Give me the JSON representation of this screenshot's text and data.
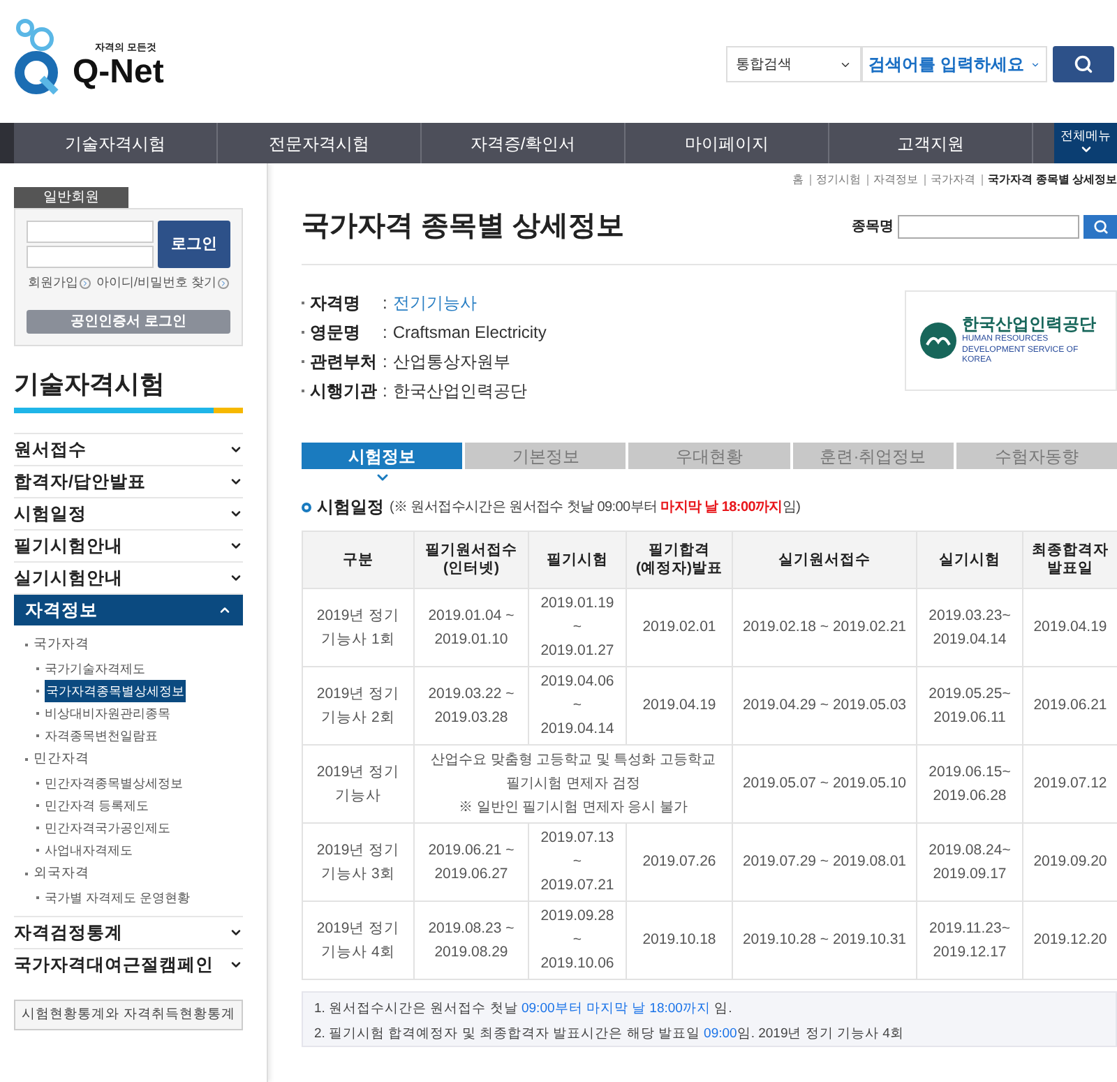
{
  "header": {
    "logo_tagline": "자격의 모든것",
    "logo_text": "Q-Net",
    "search_scope": "통합검색",
    "search_placeholder": "검색어를 입력하세요"
  },
  "nav": {
    "items": [
      "기술자격시험",
      "전문자격시험",
      "자격증/확인서",
      "마이페이지",
      "고객지원"
    ],
    "all_menu": "전체메뉴"
  },
  "sidebar": {
    "member_tab": "일반회원",
    "login_button": "로그인",
    "links": [
      "회원가입",
      "아이디/비밀번호 찾기"
    ],
    "cert_button": "공인인증서 로그인",
    "section_title": "기술자격시험",
    "menu": [
      {
        "label": "원서접수",
        "expanded": false
      },
      {
        "label": "합격자/답안발표",
        "expanded": false
      },
      {
        "label": "시험일정",
        "expanded": false
      },
      {
        "label": "필기시험안내",
        "expanded": false
      },
      {
        "label": "실기시험안내",
        "expanded": false
      },
      {
        "label": "자격정보",
        "expanded": true,
        "children": [
          {
            "label": "국가자격",
            "children": [
              {
                "label": "국가기술자격제도",
                "selected": false
              },
              {
                "label": "국가자격종목별상세정보",
                "selected": true
              },
              {
                "label": "비상대비자원관리종목",
                "selected": false
              },
              {
                "label": "자격종목변천일람표",
                "selected": false
              }
            ]
          },
          {
            "label": "민간자격",
            "children": [
              {
                "label": "민간자격종목별상세정보",
                "selected": false
              },
              {
                "label": "민간자격 등록제도",
                "selected": false
              },
              {
                "label": "민간자격국가공인제도",
                "selected": false
              },
              {
                "label": "사업내자격제도",
                "selected": false
              }
            ]
          },
          {
            "label": "외국자격",
            "children": [
              {
                "label": "국가별 자격제도 운영현황",
                "selected": false
              }
            ]
          }
        ]
      },
      {
        "label": "자격검정통계",
        "expanded": false
      },
      {
        "label": "국가자격대여근절캠페인",
        "expanded": false
      }
    ],
    "stats_button": "시험현황통계와 자격취득현황통계"
  },
  "breadcrumb": [
    "홈",
    "정기시험",
    "자격정보",
    "국가자격",
    "국가자격 종목별 상세정보"
  ],
  "page_title": "국가자격 종목별 상세정보",
  "item_search": {
    "label": "종목명"
  },
  "info": [
    {
      "label": "자격명",
      "separator": ":",
      "value": "전기기능사",
      "kind": "link"
    },
    {
      "label": "영문명",
      "separator": ":",
      "value": "Craftsman Electricity",
      "kind": "text"
    },
    {
      "label": "관련부처",
      "separator": ":",
      "value": "산업통상자원부",
      "kind": "text"
    },
    {
      "label": "시행기관",
      "separator": ":",
      "value": "한국산업인력공단",
      "kind": "text"
    }
  ],
  "agency_logo": {
    "name": "한국산업인력공단",
    "english": "HUMAN RESOURCES DEVELOPMENT SERVICE OF KOREA"
  },
  "tabs": [
    {
      "label": "시험정보",
      "selected": true
    },
    {
      "label": "기본정보",
      "selected": false
    },
    {
      "label": "우대현황",
      "selected": false
    },
    {
      "label": "훈련·취업정보",
      "selected": false
    },
    {
      "label": "수험자동향",
      "selected": false
    }
  ],
  "schedule": {
    "title": "시험일정",
    "note": [
      {
        "text": "(※ 원서접수시간은 원서접수 첫날 09:00부터 ",
        "emphasis": false
      },
      {
        "text": "마지막 날 18:00까지",
        "emphasis": true
      },
      {
        "text": "임)",
        "emphasis": false
      }
    ]
  },
  "table": {
    "columns": [
      "구분",
      "필기원서접수\n(인터넷)",
      "필기시험",
      "필기합격\n(예정자)발표",
      "실기원서접수",
      "실기시험",
      "최종합격자\n발표일"
    ],
    "rows": [
      [
        {
          "text": "2019년 정기\n기능사 1회"
        },
        {
          "text": "2019.01.04 ~\n2019.01.10"
        },
        {
          "text": "2019.01.19\n~\n2019.01.27"
        },
        {
          "text": "2019.02.01"
        },
        {
          "text": "2019.02.18 ~ 2019.02.21"
        },
        {
          "text": "2019.03.23~\n2019.04.14"
        },
        {
          "text": "2019.04.19"
        }
      ],
      [
        {
          "text": "2019년 정기\n기능사 2회"
        },
        {
          "text": "2019.03.22 ~\n2019.03.28"
        },
        {
          "text": "2019.04.06\n~\n2019.04.14"
        },
        {
          "text": "2019.04.19"
        },
        {
          "text": "2019.04.29 ~ 2019.05.03"
        },
        {
          "text": "2019.05.25~\n2019.06.11"
        },
        {
          "text": "2019.06.21"
        }
      ],
      [
        {
          "text": "2019년 정기\n기능사"
        },
        {
          "colspan": 3,
          "text": "산업수요 맞춤형 고등학교 및 특성화 고등학교\n필기시험 면제자 검정\n※ 일반인 필기시험 면제자 응시 불가"
        },
        {
          "text": "2019.05.07 ~ 2019.05.10"
        },
        {
          "text": "2019.06.15~\n2019.06.28"
        },
        {
          "text": "2019.07.12"
        }
      ],
      [
        {
          "text": "2019년 정기\n기능사 3회"
        },
        {
          "text": "2019.06.21 ~\n2019.06.27"
        },
        {
          "text": "2019.07.13\n~\n2019.07.21"
        },
        {
          "text": "2019.07.26"
        },
        {
          "text": "2019.07.29 ~ 2019.08.01"
        },
        {
          "text": "2019.08.24~\n2019.09.17"
        },
        {
          "text": "2019.09.20"
        }
      ],
      [
        {
          "text": "2019년 정기\n기능사 4회"
        },
        {
          "text": "2019.08.23 ~\n2019.08.29"
        },
        {
          "text": "2019.09.28\n~\n2019.10.06"
        },
        {
          "text": "2019.10.18"
        },
        {
          "text": "2019.10.28 ~ 2019.10.31"
        },
        {
          "text": "2019.11.23~\n2019.12.17"
        },
        {
          "text": "2019.12.20"
        }
      ]
    ]
  },
  "notes": [
    [
      {
        "text": "1. 원서접수시간은 원서접수 첫날 ",
        "emphasis": false
      },
      {
        "text": "09:00부터 마지막 날 18:00까지",
        "emphasis": true
      },
      {
        "text": " 임.",
        "emphasis": false
      }
    ],
    [
      {
        "text": "2. 필기시험 합격예정자 및 최종합격자 발표시간은 해당 발표일 ",
        "emphasis": false
      },
      {
        "text": "09:00",
        "emphasis": true
      },
      {
        "text": "임. 2019년 정기 기능사 4회",
        "emphasis": false
      }
    ]
  ]
}
